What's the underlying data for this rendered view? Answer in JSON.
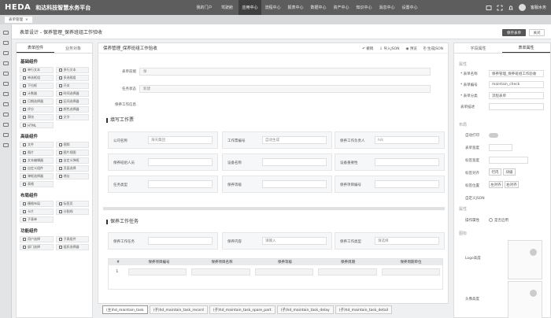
{
  "app": {
    "logo": "HEDA",
    "subtitle": "和达科技智慧水务平台"
  },
  "nav": [
    "我的门户",
    "驾驶舱",
    "应用中心",
    "流程中心",
    "报表中心",
    "数据中心",
    "资产中心",
    "知识中心",
    "消息中心",
    "设置中心"
  ],
  "nav_active": 2,
  "user": {
    "name": "客服水务"
  },
  "page_tab": {
    "label": "表单管理"
  },
  "breadcrumb": "表单设计 - 保养管理_保养班组工作验收",
  "actions": {
    "save": "保存表单",
    "close": "关闭"
  },
  "left_panel": {
    "tabs": [
      "表单控件",
      "业务对象"
    ],
    "groups": [
      {
        "title": "基础组件",
        "items": [
          "单行文本",
          "多行文本",
          "单选框组",
          "多选框组",
          "下拉框",
          "开关",
          "计数器",
          "时间选择器",
          "日期选择器",
          "区间选择器",
          "评分",
          "颜色选择器",
          "滑块",
          "文字",
          "HTML",
          ""
        ]
      },
      {
        "title": "高级组件",
        "items": [
          "文件",
          "视频",
          "图片",
          "图片视图",
          "文本编辑器",
          "自定义弹框",
          "自定义组件",
          "页面选择",
          "弹框选择器",
          "地址",
          "表格",
          "",
          ""
        ]
      },
      {
        "title": "布局组件",
        "items": [
          "栅格布局",
          "标签页",
          "卡片",
          "分割线",
          "子表单",
          ""
        ]
      },
      {
        "title": "功能组件",
        "items": [
          "用户选择",
          "子表组件",
          "部门选择",
          "组织选择器"
        ]
      }
    ]
  },
  "center": {
    "title": "保养管理_保养班组工作验收",
    "tools": [
      "撤销",
      "导入JSON",
      "预览",
      "生成JSON"
    ],
    "fields": [
      {
        "label": "表单前缀",
        "value": "保"
      },
      {
        "label": "任务状态",
        "value": "新建"
      },
      {
        "label": "保养工作信息",
        "value": ""
      }
    ],
    "section1": "填写工作票",
    "cards": [
      {
        "label": "公司名称",
        "value": "海天集团"
      },
      {
        "label": "工作票编号",
        "value": "自动生成"
      },
      {
        "label": "保养工作负责人",
        "value": "h/k"
      },
      {
        "label": "保养班组人员",
        "value": ""
      },
      {
        "label": "设备名称",
        "value": ""
      },
      {
        "label": "设备重要性",
        "value": ""
      },
      {
        "label": "任务类型",
        "value": ""
      },
      {
        "label": "保养等级",
        "value": ""
      },
      {
        "label": "保养项目编号",
        "value": ""
      }
    ],
    "section2": "保养工作任务",
    "cards2": [
      {
        "label": "保养工作任务",
        "value": ""
      },
      {
        "label": "保养内容",
        "value": "请输入"
      },
      {
        "label": "保养工作类型",
        "value": "请选择"
      }
    ],
    "table_headers": [
      "#",
      "保养项目编号",
      "保养项目名称",
      "保养等级",
      "保养周期",
      "保养周期单位"
    ],
    "table_row_index": "1"
  },
  "right_panel": {
    "tabs": [
      "字段属性",
      "表单属性"
    ],
    "sect_basic": "属性",
    "rows": [
      {
        "label": "* 表单名称",
        "value": "保养管理_保养班组工作验收"
      },
      {
        "label": "* 表单编号",
        "value": "maintain_check"
      },
      {
        "label": "* 表单分类",
        "value": "流程表单"
      },
      {
        "label": "表单描述",
        "value": ""
      }
    ],
    "sect_layout": "布局",
    "layout_rows": [
      "自动打印",
      "表单宽度",
      "标签宽度",
      "标签对齐",
      "标签位置",
      "自定义JSON"
    ],
    "label_pos": [
      "行内",
      "块级"
    ],
    "label_align": [
      "左对齐",
      "右对齐"
    ],
    "sect_attr": "属性",
    "op_label": "操作属性",
    "op_value": "是否启用",
    "sect_icon": "图标",
    "logo_labels": [
      "Logo高度",
      "头像高度"
    ]
  },
  "bottom_tabs": [
    "(主)hd_maintain_task",
    "(子)hd_maintain_task_record",
    "(子)hd_maintain_task_spare_part",
    "(子)hd_maintain_task_delay",
    "(子)hd_maintain_task_detail"
  ]
}
